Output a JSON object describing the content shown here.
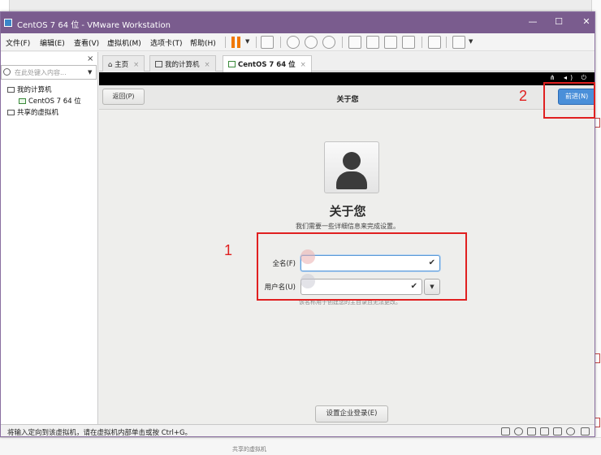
{
  "window": {
    "title": "CentOS 7 64 位 - VMware Workstation",
    "controls": {
      "minimize": "—",
      "maximize": "☐",
      "close": "✕"
    }
  },
  "menubar": {
    "items": [
      "文件(F)",
      "编辑(E)",
      "查看(V)",
      "虚拟机(M)",
      "选项卡(T)",
      "帮助(H)"
    ],
    "pause_color": "#f07800"
  },
  "sidebar": {
    "close": "×",
    "search_placeholder": "在此处键入内容...",
    "search_dropdown": "▼",
    "tree": [
      "我的计算机",
      "CentOS 7 64 位",
      "共享的虚拟机"
    ]
  },
  "tabs": [
    {
      "label": "主页",
      "close": "×"
    },
    {
      "label": "我的计算机",
      "close": "×"
    },
    {
      "label": "CentOS 7 64 位",
      "close": "×",
      "active": true
    }
  ],
  "guest": {
    "status_icons": "⋔ ◂) ⏻",
    "back_label": "返回(P)",
    "header_title": "关于您",
    "next_label": "前进(N)",
    "heading": "关于您",
    "subheading": "我们需要一些详细信息来完成设置。",
    "fullname_label": "全名(F)",
    "fullname_value": "",
    "username_label": "用户名(U)",
    "username_value": "",
    "check": "✔",
    "dropdown": "▼",
    "hint": "该名称用于创建您的主目录且无法更改。",
    "enterprise_label": "设置企业登录(E)"
  },
  "annotations": {
    "box1_number": "1",
    "box2_number": "2",
    "color": "#e02020"
  },
  "statusbar": {
    "text": "将输入定向到该虚拟机，请在虚拟机内部单击或按 Ctrl+G。"
  },
  "background": {
    "bottom_text": "共享的虚拟机"
  }
}
